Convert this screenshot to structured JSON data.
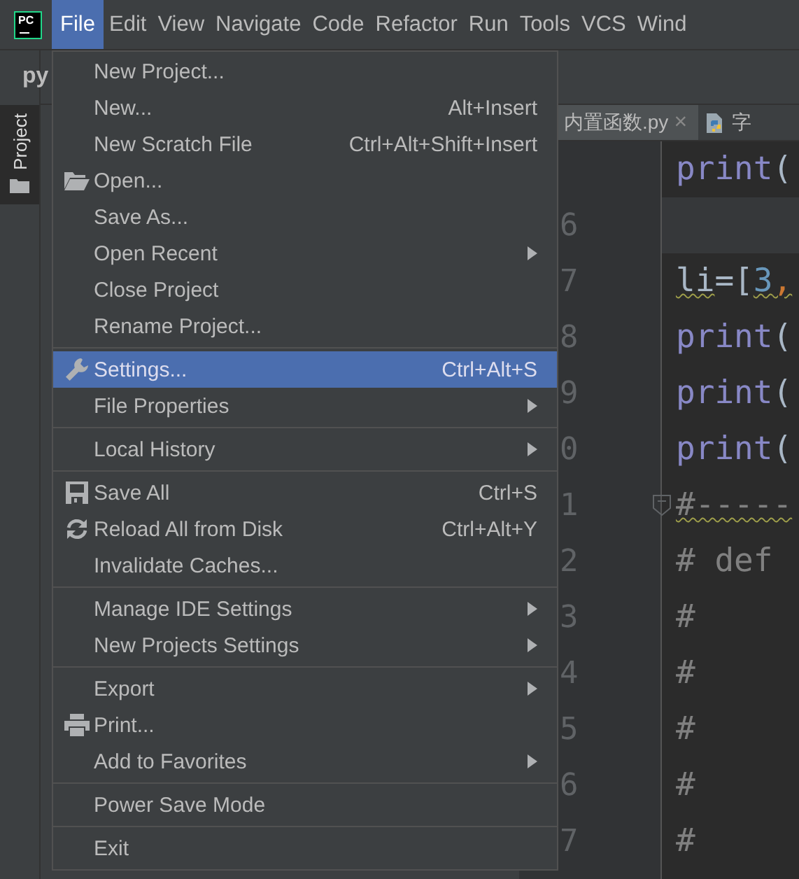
{
  "app": {
    "logo": "PC"
  },
  "menubar": [
    {
      "label": "File",
      "selected": true
    },
    {
      "label": "Edit",
      "selected": false
    },
    {
      "label": "View",
      "selected": false
    },
    {
      "label": "Navigate",
      "selected": false
    },
    {
      "label": "Code",
      "selected": false
    },
    {
      "label": "Refactor",
      "selected": false
    },
    {
      "label": "Run",
      "selected": false
    },
    {
      "label": "Tools",
      "selected": false
    },
    {
      "label": "VCS",
      "selected": false
    },
    {
      "label": "Wind",
      "selected": false
    }
  ],
  "toolbar": {
    "project_name": "py"
  },
  "tool_window_tab": {
    "label": "Project"
  },
  "editor_tabs": [
    {
      "label": "内置函数.py",
      "close": "×",
      "selected": true
    },
    {
      "label": "字",
      "selected": false
    }
  ],
  "code_lines": [
    {
      "current": false,
      "segments": [
        {
          "text": "print",
          "kind": "builtin",
          "warning": false
        },
        {
          "text": "(",
          "kind": "plain",
          "warning": false
        }
      ]
    },
    {
      "number": "6",
      "current": true
    },
    {
      "number": "7",
      "current": false,
      "segments": [
        {
          "text": "li",
          "kind": "plain",
          "warning": true
        },
        {
          "text": "=[",
          "kind": "plain",
          "warning": false
        },
        {
          "text": "3",
          "kind": "number",
          "warning": true
        },
        {
          "text": ",",
          "kind": "punct",
          "warning": true
        }
      ]
    },
    {
      "number": "8",
      "current": false,
      "segments": [
        {
          "text": "print",
          "kind": "builtin",
          "warning": false
        },
        {
          "text": "(",
          "kind": "plain",
          "warning": false
        }
      ]
    },
    {
      "number": "9",
      "current": false,
      "segments": [
        {
          "text": "print",
          "kind": "builtin",
          "warning": false
        },
        {
          "text": "(",
          "kind": "plain",
          "warning": false
        }
      ]
    },
    {
      "number": "0",
      "current": false,
      "segments": [
        {
          "text": "print",
          "kind": "builtin",
          "warning": false
        },
        {
          "text": "(",
          "kind": "plain",
          "warning": false
        }
      ]
    },
    {
      "number": "1",
      "current": false,
      "fold": true,
      "segments": [
        {
          "text": "#-----",
          "kind": "comment",
          "warning": true
        }
      ]
    },
    {
      "number": "2",
      "current": false,
      "segments": [
        {
          "text": "# def",
          "kind": "comment",
          "warning": false
        }
      ]
    },
    {
      "number": "3",
      "current": false,
      "segments": [
        {
          "text": "#",
          "kind": "comment",
          "warning": false
        }
      ]
    },
    {
      "number": "4",
      "current": false,
      "segments": [
        {
          "text": "#",
          "kind": "comment",
          "warning": false
        }
      ]
    },
    {
      "number": "5",
      "current": false,
      "segments": [
        {
          "text": "#",
          "kind": "comment",
          "warning": false
        }
      ]
    },
    {
      "number": "6",
      "current": false,
      "segments": [
        {
          "text": "#",
          "kind": "comment",
          "warning": false
        }
      ]
    },
    {
      "number": "7",
      "current": false,
      "segments": [
        {
          "text": "#",
          "kind": "comment",
          "warning": false
        }
      ]
    }
  ],
  "file_menu": {
    "groups": [
      [
        {
          "label": "New Project...",
          "submenu": false,
          "selected": false
        },
        {
          "label": "New...",
          "shortcut": "Alt+Insert",
          "submenu": false,
          "selected": false
        },
        {
          "label": "New Scratch File",
          "shortcut": "Ctrl+Alt+Shift+Insert",
          "submenu": false,
          "selected": false
        },
        {
          "label": "Open...",
          "submenu": false,
          "selected": false
        },
        {
          "label": "Save As...",
          "submenu": false,
          "selected": false
        },
        {
          "label": "Open Recent",
          "submenu": true,
          "selected": false
        },
        {
          "label": "Close Project",
          "submenu": false,
          "selected": false
        },
        {
          "label": "Rename Project...",
          "submenu": false,
          "selected": false
        }
      ],
      [
        {
          "label": "Settings...",
          "shortcut": "Ctrl+Alt+S",
          "submenu": false,
          "selected": true
        },
        {
          "label": "File Properties",
          "submenu": true,
          "selected": false
        }
      ],
      [
        {
          "label": "Local History",
          "submenu": true,
          "selected": false
        }
      ],
      [
        {
          "label": "Save All",
          "shortcut": "Ctrl+S",
          "submenu": false,
          "selected": false
        },
        {
          "label": "Reload All from Disk",
          "shortcut": "Ctrl+Alt+Y",
          "submenu": false,
          "selected": false
        },
        {
          "label": "Invalidate Caches...",
          "submenu": false,
          "selected": false
        }
      ],
      [
        {
          "label": "Manage IDE Settings",
          "submenu": true,
          "selected": false
        },
        {
          "label": "New Projects Settings",
          "submenu": true,
          "selected": false
        }
      ],
      [
        {
          "label": "Export",
          "submenu": true,
          "selected": false
        },
        {
          "label": "Print...",
          "submenu": false,
          "selected": false
        },
        {
          "label": "Add to Favorites",
          "submenu": true,
          "selected": false
        }
      ],
      [
        {
          "label": "Power Save Mode",
          "submenu": false,
          "selected": false
        }
      ],
      [
        {
          "label": "Exit",
          "submenu": false,
          "selected": false
        }
      ]
    ]
  }
}
